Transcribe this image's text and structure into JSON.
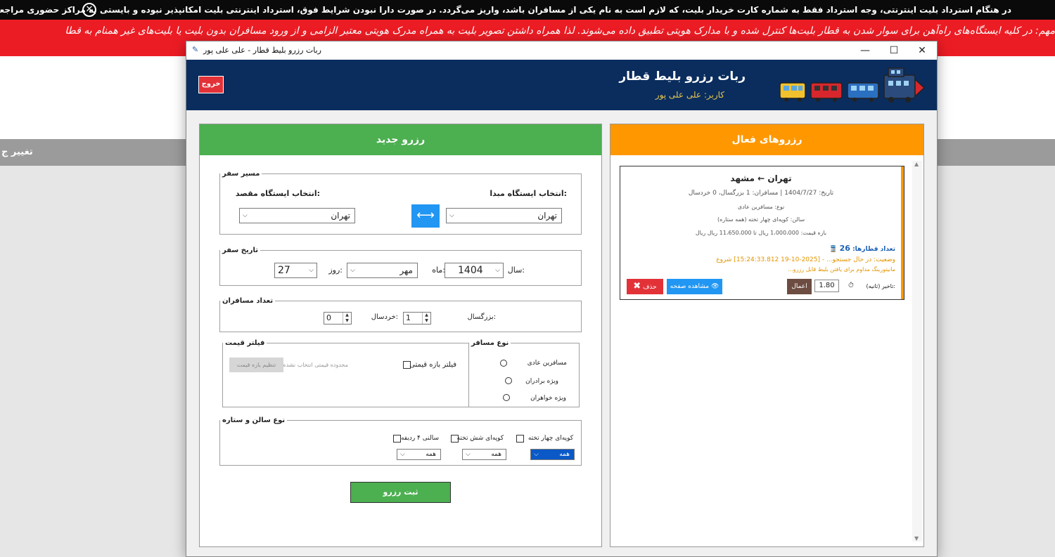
{
  "background": {
    "notice_line1": "در هنگام استرداد بلیت اینترنتی، وجه استرداد فقط به شماره کارت خریدار بلیت، که لازم است به نام یکی از مسافران باشد، واریز می‌گردد. در صورت دارا نبودن شرایط فوق، استرداد اینترنتی بلیت امکانپذیر نبوده و بایستی به مراکز حضوری مراجعه شود",
    "notice_line2": "مهم: در کلیه ایستگاه‌های راه‌آهن برای سوار شدن به قطار بلیت‌ها کنترل شده و با مدارک هویتی تطبیق داده می‌شوند. لذا همراه داشتن تصویر بلیت به همراه مدرک هویتی معتبر الزامی و از ورود مسافران بدون بلیت یا بلیت‌های غیر همنام به قطا",
    "graybar_text": "تغییر ج"
  },
  "window": {
    "title": "ربات رزرو بلیط قطار - علی علی پور",
    "minimize": "—",
    "maximize": "☐",
    "close": "✕"
  },
  "header": {
    "title": "ربات رزرو بلیط قطار",
    "user": "کاربر: علی علی پور",
    "exit_label": "خروج"
  },
  "new_booking": {
    "title": "رزرو جدید",
    "route": {
      "legend": "مسیر سفر",
      "origin_label": ":انتخاب ایستگاه مبدا",
      "destination_label": ":انتخاب ایستگاه مقصد",
      "origin_value": "تهران",
      "destination_value": "تهران",
      "swap_icon": "⟷"
    },
    "date": {
      "legend": "تاریخ سفر",
      "year_label": ":سال",
      "month_label": ":ماه",
      "day_label": ":روز",
      "year": "1404",
      "month": "مهر",
      "day": "27"
    },
    "passengers": {
      "legend": "تعداد مسافران",
      "adult_label": ":بزرگسال",
      "child_label": ":خردسال",
      "adults": "1",
      "children": "0"
    },
    "price_filter": {
      "legend": "فیلتر قیمت",
      "checkbox_label": "فیلتر بازه قیمتی",
      "status": "محدوده قیمتی انتخاب نشده",
      "button": "تنظیم بازه قیمت"
    },
    "passenger_type": {
      "legend": "نوع مسافر",
      "options": [
        "مسافرین عادی",
        "ویژه برادران",
        "ویژه خواهران"
      ]
    },
    "salon": {
      "legend": "نوع سالن و ستاره",
      "types": [
        "کوپه‌ای چهار تخته",
        "کوپه‌ای شش تخته",
        "سالنی ۴ ردیفه"
      ],
      "values": [
        "همه",
        "همه",
        "همه"
      ]
    },
    "submit": "ثبت رزرو"
  },
  "active_bookings": {
    "title": "رزروهای فعال",
    "card": {
      "route": "تهران ← مشهد",
      "line1": "تاریخ: 1404/7/27 | مسافران: 1 بزرگسال، 0 خردسال",
      "line2": "نوع: مسافرین عادی",
      "line3": "سالن: کوپه‌ای چهار تخته (همه ستاره)",
      "line4": "بازه قیمت: 1،000،000 ریال تا 11،650،000 ریال ریال",
      "trains_label": "تعداد قطارها:",
      "trains_count": "26",
      "status_line1": "وضعیت: در حال جستجو... - [2025-10-19 15:24:33.812] شروع",
      "status_line2": "مانیتورینگ مداوم برای یافتن بلیط قابل رزرو...",
      "delay_label": ":تاخیر (ثانیه)",
      "delay_value": "1.80",
      "apply_button": "اعمال",
      "view_button": "مشاهده صفحه",
      "delete_button": "حذف"
    }
  },
  "colors": {
    "header": "#0a2d5e",
    "green": "#4caf50",
    "orange": "#ff9800",
    "red": "#e23238",
    "blue_btn": "#2196f3",
    "brown_btn": "#6d4c41"
  }
}
